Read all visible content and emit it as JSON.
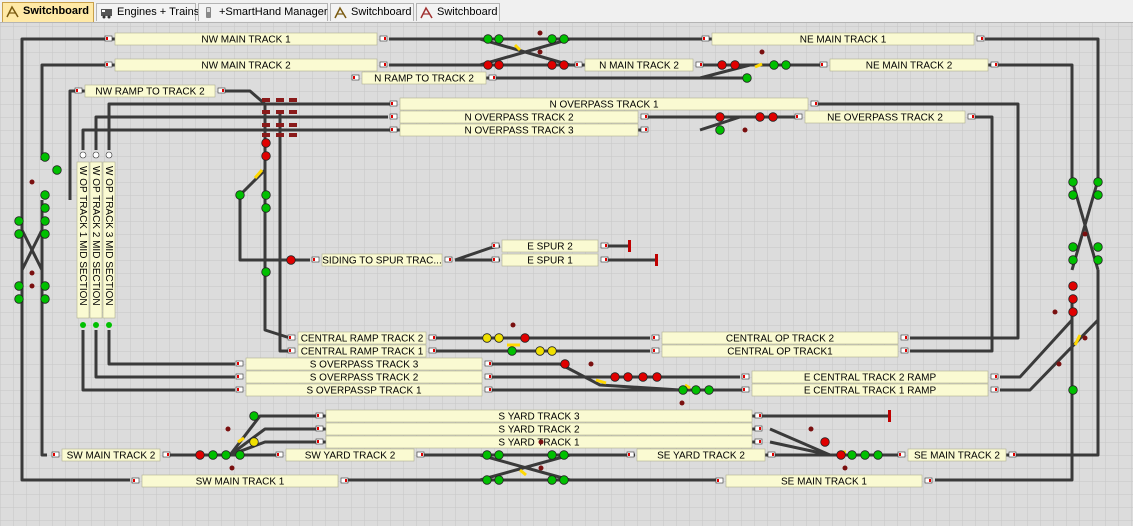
{
  "tabs": [
    {
      "label": "Switchboard",
      "icon": "switchboard-icon",
      "active": true
    },
    {
      "label": "Engines + Trains",
      "icon": "engine-icon",
      "active": false
    },
    {
      "label": "+SmartHand Manager",
      "icon": "smarthand-icon",
      "active": false
    },
    {
      "label": "Switchboard",
      "icon": "switchboard-icon",
      "active": false
    },
    {
      "label": "Switchboard",
      "icon": "switchboard-icon",
      "active": false
    }
  ],
  "colors": {
    "grid_bg": "#dcdcdc",
    "grid_line": "#c8c8c8",
    "track": "#3a3a3a",
    "label_bg": "#fafad2",
    "signal_red": "#e00000",
    "signal_green": "#00c000",
    "signal_yellow": "#f0e000",
    "occupied": "#ffd800"
  },
  "tracks": {
    "nw_main_1": "NW MAIN TRACK 1",
    "ne_main_1": "NE MAIN TRACK 1",
    "nw_main_2": "NW MAIN TRACK 2",
    "n_main_2": "N MAIN TRACK 2",
    "ne_main_2": "NE MAIN TRACK 2",
    "n_ramp_2": "N RAMP TO TRACK 2",
    "nw_ramp_2": "NW RAMP TO TRACK 2",
    "n_overpass_1": "N OVERPASS TRACK 1",
    "n_overpass_2": "N OVERPASS TRACK 2",
    "n_overpass_3": "N OVERPASS TRACK 3",
    "ne_overpass_2": "NE OVERPASS TRACK 2",
    "siding": "SIDING TO SPUR TRAC...",
    "e_spur_2": "E SPUR 2",
    "e_spur_1": "E SPUR 1",
    "w_op_1": "W OP TRACK 1 MID SECTION",
    "w_op_2": "W OP TRACK 2 MID SECTION",
    "w_op_3": "W OP TRACK 3 MID SECTION",
    "central_ramp_2": "CENTRAL RAMP TRACK 2",
    "central_ramp_1": "CENTRAL RAMP TRACK 1",
    "central_op_2": "CENTRAL OP TRACK 2",
    "central_op_1": "CENTRAL OP TRACK1",
    "s_overpass_3": "S OVERPASS TRACK 3",
    "s_overpass_2": "S OVERPASS TRACK 2",
    "s_overpass_1": "S OVERPASSP TRACK 1",
    "e_central_2_ramp": "E CENTRAL TRACK 2 RAMP",
    "e_central_1_ramp": "E CENTRAL TRACK 1 RAMP",
    "s_yard_3": "S YARD TRACK 3",
    "s_yard_2": "S YARD TRACK 2",
    "s_yard_1": "S YARD TRACK 1",
    "sw_main_2": "SW MAIN TRACK 2",
    "sw_yard_2": "SW YARD TRACK 2",
    "se_yard_2": "SE YARD TRACK 2",
    "se_main_2": "SE MAIN TRACK 2",
    "sw_main_1": "SW MAIN TRACK 1",
    "se_main_1": "SE MAIN TRACK 1"
  }
}
